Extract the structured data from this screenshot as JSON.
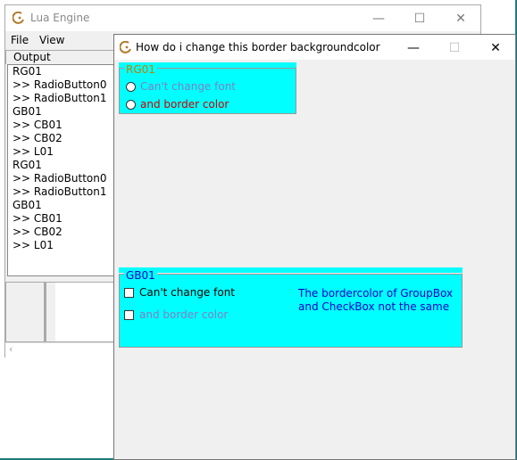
{
  "lua_window": {
    "title": "Lua Engine",
    "menu": [
      "File",
      "View"
    ],
    "output_label": "Output",
    "output_lines": [
      "RG01",
      ">> RadioButton0",
      ">> RadioButton1",
      "GB01",
      ">> CB01",
      ">> CB02",
      ">> L01",
      "RG01",
      ">> RadioButton0",
      ">> RadioButton1",
      "GB01",
      ">> CB01",
      ">> CB02",
      ">> L01"
    ],
    "caption_minimize": "—",
    "caption_maximize": "☐",
    "caption_close": "✕",
    "scroll_left_arrow": "‹"
  },
  "dialog": {
    "title": "How do i change this border backgroundcolor",
    "caption_minimize": "—",
    "caption_maximize": "☐",
    "caption_close": "✕",
    "radio_group": {
      "caption": "RG01",
      "options": [
        "Can't change font",
        "and border color"
      ]
    },
    "group_box": {
      "caption": "GB01",
      "checkboxes": [
        "Can't change font",
        "and border color"
      ],
      "note_lines": [
        "The bordercolor of GroupBox",
        "and CheckBox not the same"
      ]
    }
  },
  "colors": {
    "group_background": "#00ffff",
    "rg_caption_color": "#c08000",
    "rg_option1_color": "#8080c0",
    "rg_option2_color": "#cc0000",
    "gb_caption_color": "#0000cc",
    "gb_check1_color": "#000000",
    "gb_check2_color": "#8080c0",
    "note_color": "#0000cc"
  }
}
